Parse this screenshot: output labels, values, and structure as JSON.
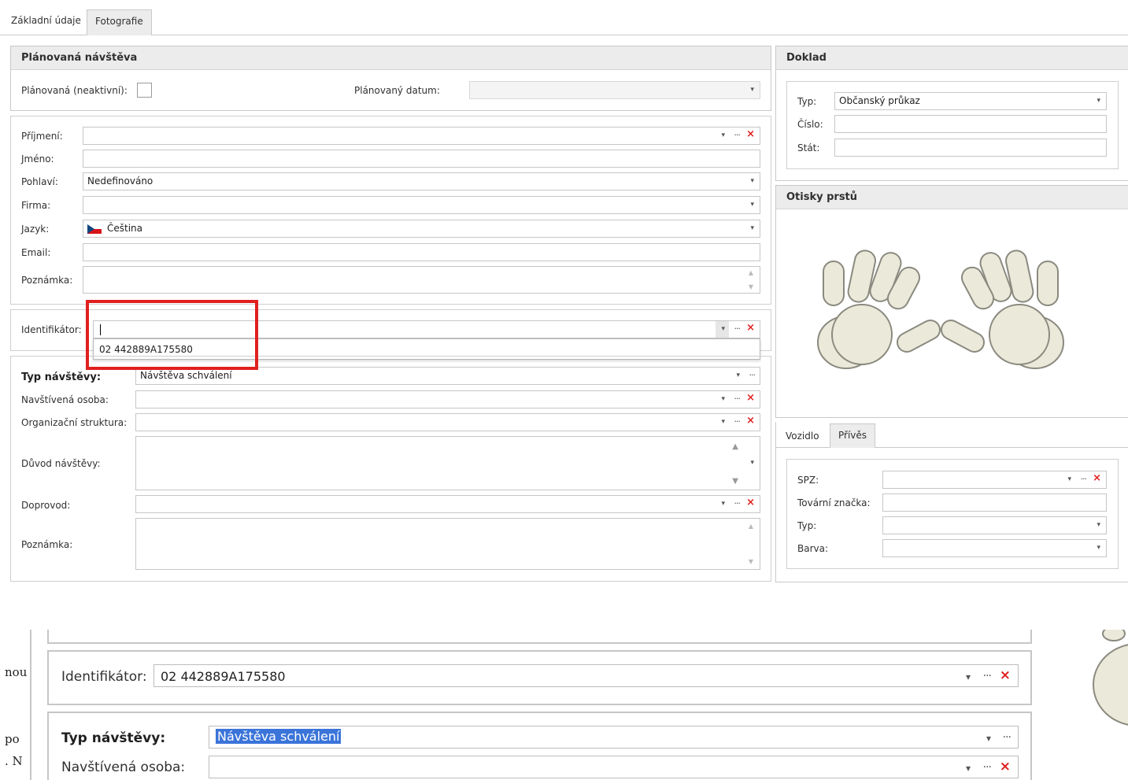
{
  "tabs": [
    "Základní údaje",
    "Fotografie"
  ],
  "planned": {
    "title": "Plánovaná návštěva",
    "inactive_label": "Plánovaná (neaktivní):",
    "date_label": "Plánovaný datum:"
  },
  "person": {
    "surname_label": "Příjmení:",
    "name_label": "Jméno:",
    "gender_label": "Pohlaví:",
    "gender_value": "Nedefinováno",
    "company_label": "Firma:",
    "language_label": "Jazyk:",
    "language_value": "Čeština",
    "email_label": "Email:",
    "note_label": "Poznámka:"
  },
  "identifier": {
    "label": "Identifikátor:",
    "dropdown_item": "02 442889A175580"
  },
  "visit": {
    "type_label": "Typ návštěvy:",
    "type_value": "Návštěva schválení",
    "visited_label": "Navštívená osoba:",
    "org_label": "Organizační struktura:",
    "reason_label": "Důvod návštěvy:",
    "escort_label": "Doprovod:",
    "note_label": "Poznámka:"
  },
  "document": {
    "title": "Doklad",
    "type_label": "Typ:",
    "type_value": "Občanský průkaz",
    "number_label": "Číslo:",
    "country_label": "Stát:"
  },
  "fingerprints": {
    "title": "Otisky prstů"
  },
  "vehicle": {
    "tabs": [
      "Vozidlo",
      "Přívěs"
    ],
    "spz_label": "SPZ:",
    "brand_label": "Tovární značka:",
    "type_label": "Typ:",
    "color_label": "Barva:"
  },
  "zoom": {
    "identifier_label": "Identifikátor:",
    "identifier_value": "02 442889A175580",
    "type_label": "Typ návštěvy:",
    "type_value": "Návštěva schválení",
    "visited_label": "Navštívená osoba:",
    "side_texts": [
      "nou",
      "po",
      ". N"
    ]
  },
  "icons": {
    "dropdown": "▾",
    "ellipsis": "···",
    "clear": "×"
  },
  "colors": {
    "highlight_box": "#e0201f",
    "selection": "#3b74d9",
    "clear_icon": "#e0201f"
  }
}
